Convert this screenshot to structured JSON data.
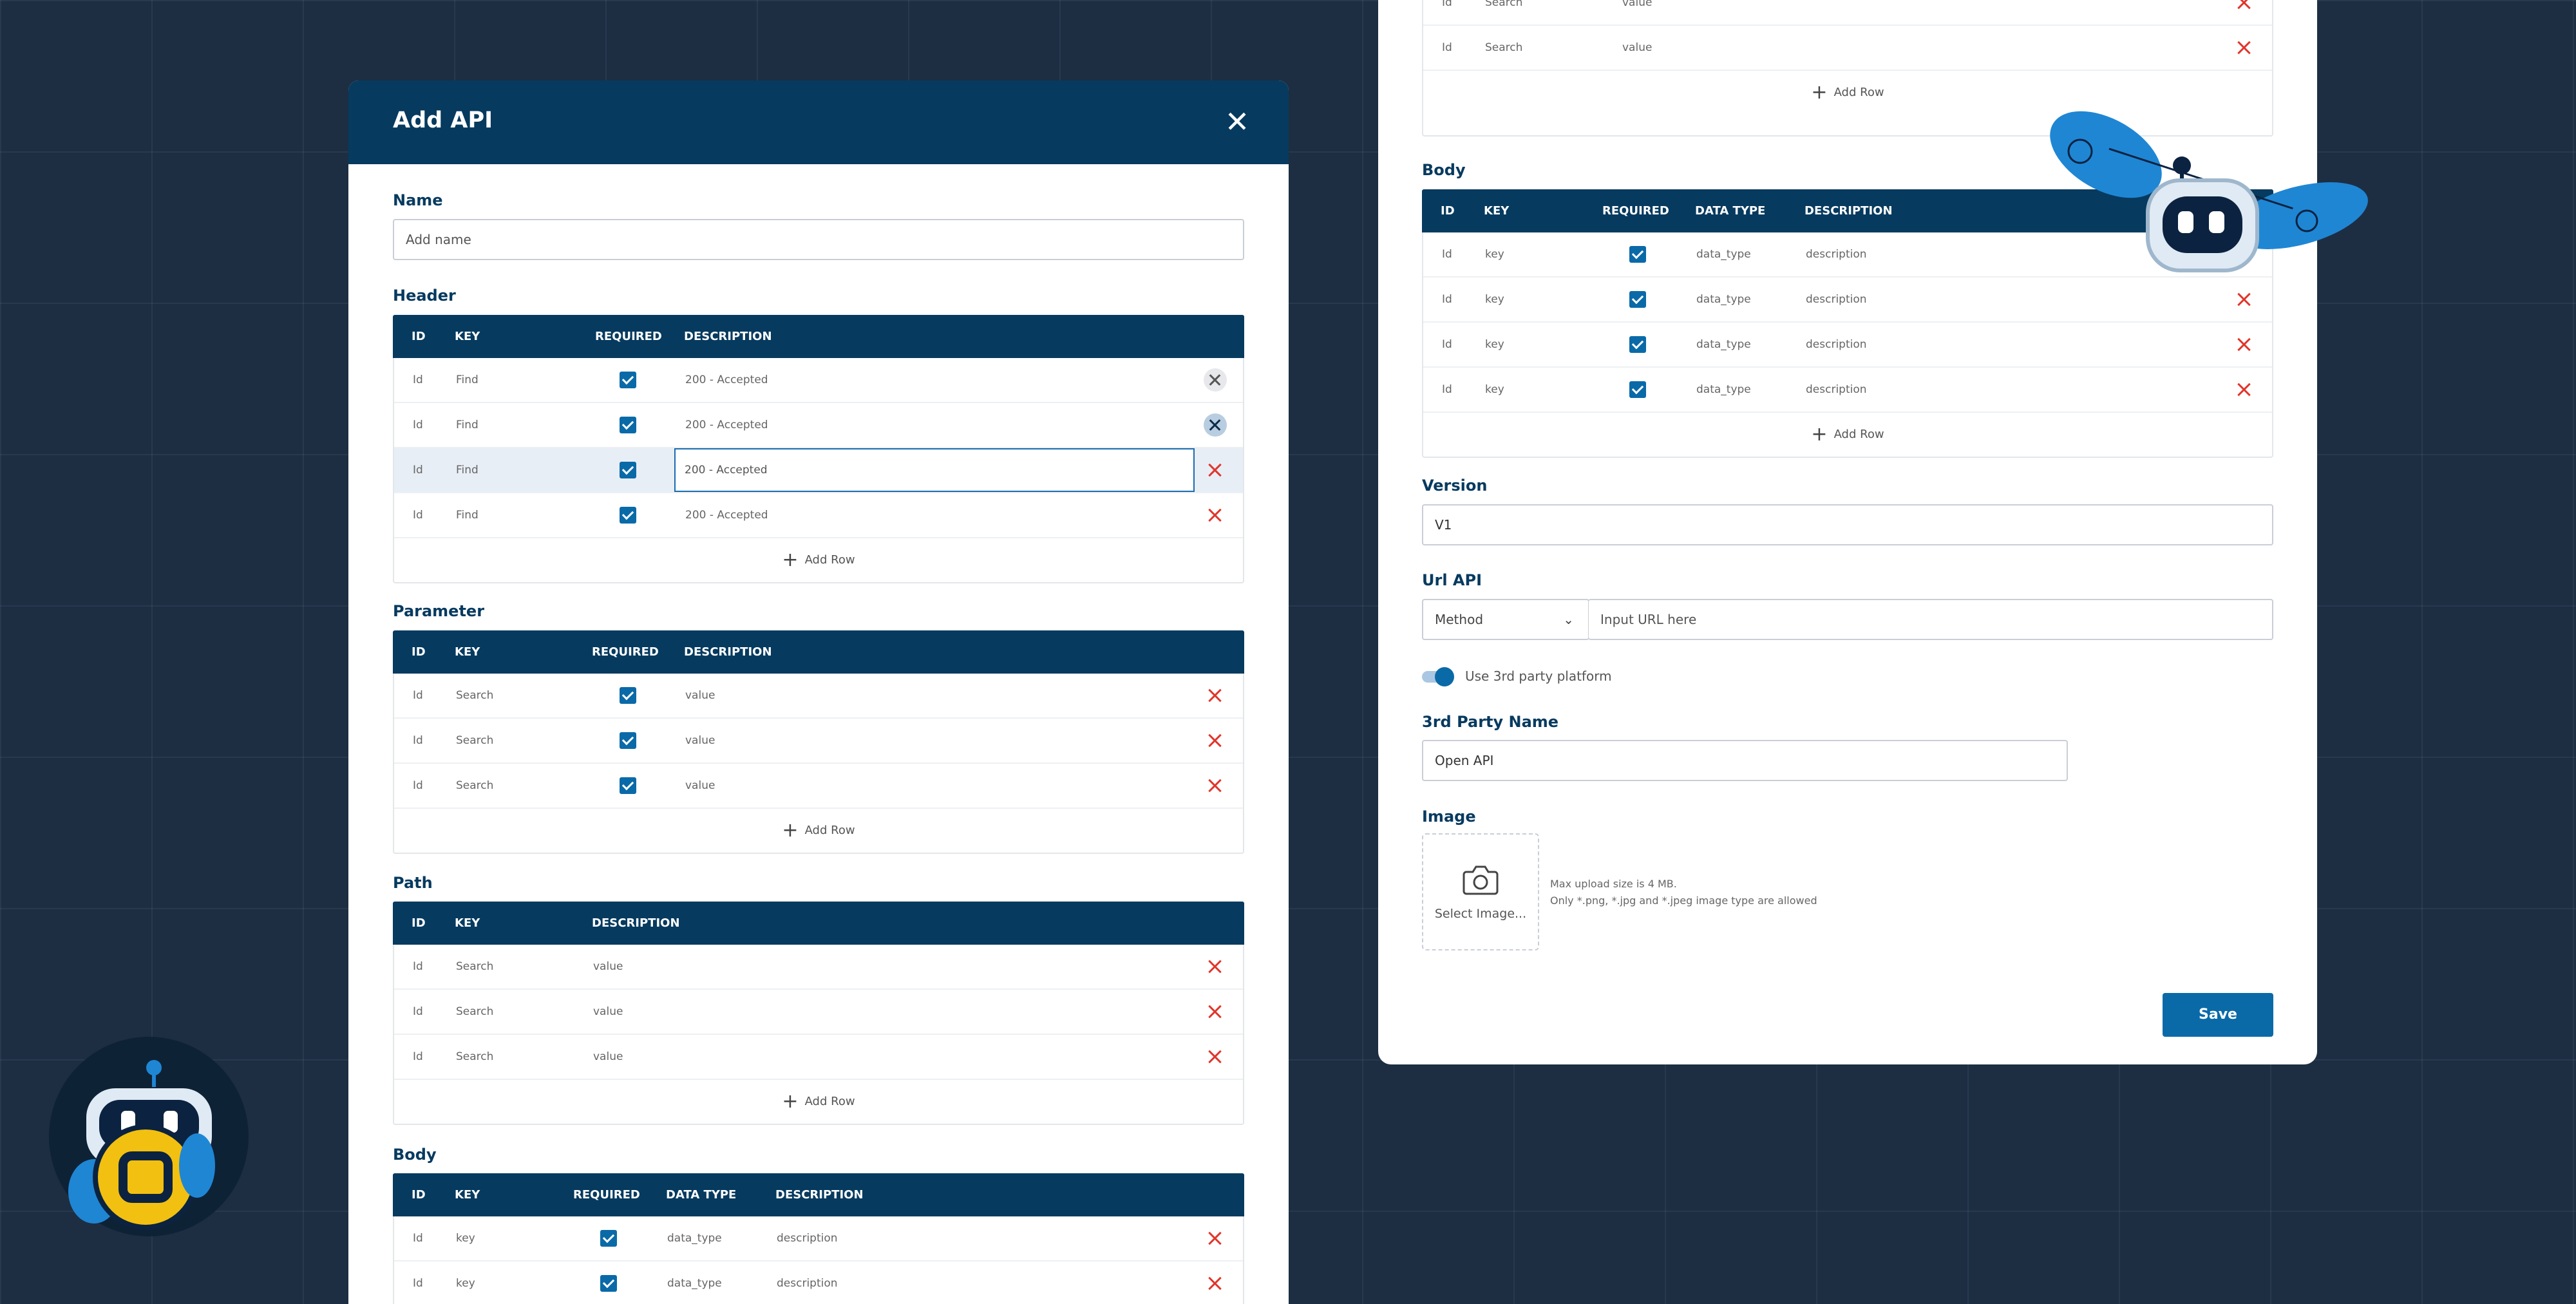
{
  "colors": {
    "background": "#1d2e43",
    "header": "#063a5f",
    "accent": "#0a6aa8",
    "delete": "#e0362c"
  },
  "left": {
    "title": "Add API",
    "name": {
      "label": "Name",
      "placeholder": "Add name"
    },
    "header_section": {
      "label": "Header",
      "columns": [
        "ID",
        "KEY",
        "REQUIRED",
        "DESCRIPTION"
      ],
      "rows": [
        {
          "id": "Id",
          "key": "Find",
          "required": true,
          "desc": "200 - Accepted"
        },
        {
          "id": "Id",
          "key": "Find",
          "required": true,
          "desc": "200 - Accepted"
        },
        {
          "id": "Id",
          "key": "Find",
          "required": true,
          "desc": "200 - Accepted"
        },
        {
          "id": "Id",
          "key": "Find",
          "required": true,
          "desc": "200 - Accepted"
        }
      ],
      "add_row": "Add Row"
    },
    "parameter": {
      "label": "Parameter",
      "columns": [
        "ID",
        "KEY",
        "REQUIRED",
        "DESCRIPTION"
      ],
      "rows": [
        {
          "id": "Id",
          "key": "Search",
          "required": true,
          "desc": "value"
        },
        {
          "id": "Id",
          "key": "Search",
          "required": true,
          "desc": "value"
        },
        {
          "id": "Id",
          "key": "Search",
          "required": true,
          "desc": "value"
        }
      ],
      "add_row": "Add Row"
    },
    "path": {
      "label": "Path",
      "columns": [
        "ID",
        "KEY",
        "DESCRIPTION"
      ],
      "rows": [
        {
          "id": "Id",
          "key": "Search",
          "desc": "value"
        },
        {
          "id": "Id",
          "key": "Search",
          "desc": "value"
        },
        {
          "id": "Id",
          "key": "Search",
          "desc": "value"
        }
      ],
      "add_row": "Add Row"
    },
    "body": {
      "label": "Body",
      "columns": [
        "ID",
        "KEY",
        "REQUIRED",
        "DATA TYPE",
        "DESCRIPTION"
      ],
      "rows": [
        {
          "id": "Id",
          "key": "key",
          "required": true,
          "type": "data_type",
          "desc": "description"
        },
        {
          "id": "Id",
          "key": "key",
          "required": true,
          "type": "data_type",
          "desc": "description"
        }
      ]
    }
  },
  "right": {
    "top_rows": [
      {
        "id": "Id",
        "key": "Search",
        "desc": "value"
      },
      {
        "id": "Id",
        "key": "Search",
        "desc": "value"
      }
    ],
    "top_add_row": "Add Row",
    "body": {
      "label": "Body",
      "columns": [
        "ID",
        "KEY",
        "REQUIRED",
        "DATA TYPE",
        "DESCRIPTION"
      ],
      "rows": [
        {
          "id": "Id",
          "key": "key",
          "required": true,
          "type": "data_type",
          "desc": "description"
        },
        {
          "id": "Id",
          "key": "key",
          "required": true,
          "type": "data_type",
          "desc": "description"
        },
        {
          "id": "Id",
          "key": "key",
          "required": true,
          "type": "data_type",
          "desc": "description"
        },
        {
          "id": "Id",
          "key": "key",
          "required": true,
          "type": "data_type",
          "desc": "description"
        }
      ],
      "add_row": "Add Row"
    },
    "version": {
      "label": "Version",
      "value": "V1"
    },
    "url_api": {
      "label": "Url API",
      "method": "Method",
      "placeholder": "Input URL here"
    },
    "toggle": {
      "label": "Use 3rd party platform",
      "on": true
    },
    "third_party": {
      "label": "3rd Party Name",
      "value": "Open API"
    },
    "image": {
      "label": "Image",
      "select": "Select Image...",
      "hint1": "Max upload size is 4 MB.",
      "hint2": "Only *.png, *.jpg and *.jpeg image type are allowed"
    },
    "save": "Save"
  }
}
